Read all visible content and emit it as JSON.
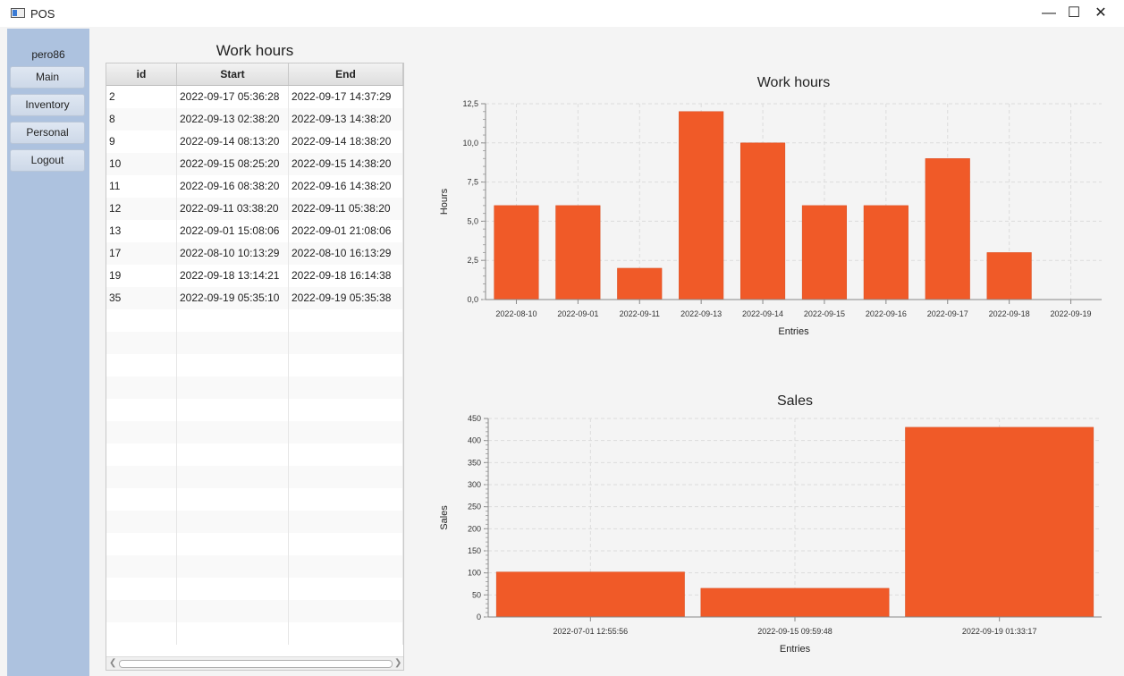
{
  "window": {
    "title": "POS",
    "minimize": "—",
    "maximize": "☐",
    "close": "✕"
  },
  "sidebar": {
    "username": "pero86",
    "items": [
      {
        "label": "Main"
      },
      {
        "label": "Inventory"
      },
      {
        "label": "Personal"
      },
      {
        "label": "Logout"
      }
    ]
  },
  "table": {
    "title": "Work hours",
    "columns": [
      "id",
      "Start",
      "End"
    ],
    "rows": [
      [
        "2",
        "2022-09-17 05:36:28",
        "2022-09-17 14:37:29"
      ],
      [
        "8",
        "2022-09-13 02:38:20",
        "2022-09-13 14:38:20"
      ],
      [
        "9",
        "2022-09-14 08:13:20",
        "2022-09-14 18:38:20"
      ],
      [
        "10",
        "2022-09-15 08:25:20",
        "2022-09-15 14:38:20"
      ],
      [
        "11",
        "2022-09-16 08:38:20",
        "2022-09-16 14:38:20"
      ],
      [
        "12",
        "2022-09-11 03:38:20",
        "2022-09-11 05:38:20"
      ],
      [
        "13",
        "2022-09-01 15:08:06",
        "2022-09-01 21:08:06"
      ],
      [
        "17",
        "2022-08-10 10:13:29",
        "2022-08-10 16:13:29"
      ],
      [
        "19",
        "2022-09-18 13:14:21",
        "2022-09-18 16:14:38"
      ],
      [
        "35",
        "2022-09-19 05:35:10",
        "2022-09-19 05:35:38"
      ]
    ]
  },
  "chart_data": [
    {
      "type": "bar",
      "title": "Work hours",
      "xlabel": "Entries",
      "ylabel": "Hours",
      "categories": [
        "2022-08-10",
        "2022-09-01",
        "2022-09-11",
        "2022-09-13",
        "2022-09-14",
        "2022-09-15",
        "2022-09-16",
        "2022-09-17",
        "2022-09-18",
        "2022-09-19"
      ],
      "values": [
        6,
        6,
        2,
        12,
        10,
        6,
        6,
        9,
        3,
        0
      ],
      "ylim": [
        0,
        12.5
      ],
      "yticks": [
        "0,0",
        "2,5",
        "5,0",
        "7,5",
        "10,0",
        "12,5"
      ],
      "grid": true,
      "color": "#f05a28"
    },
    {
      "type": "bar",
      "title": "Sales",
      "xlabel": "Entries",
      "ylabel": "Sales",
      "categories": [
        "2022-07-01 12:55:56",
        "2022-09-15 09:59:48",
        "2022-09-19 01:33:17"
      ],
      "values": [
        102,
        65,
        430
      ],
      "ylim": [
        0,
        450
      ],
      "yticks": [
        "0",
        "50",
        "100",
        "150",
        "200",
        "250",
        "300",
        "350",
        "400",
        "450"
      ],
      "grid": true,
      "color": "#f05a28"
    }
  ]
}
